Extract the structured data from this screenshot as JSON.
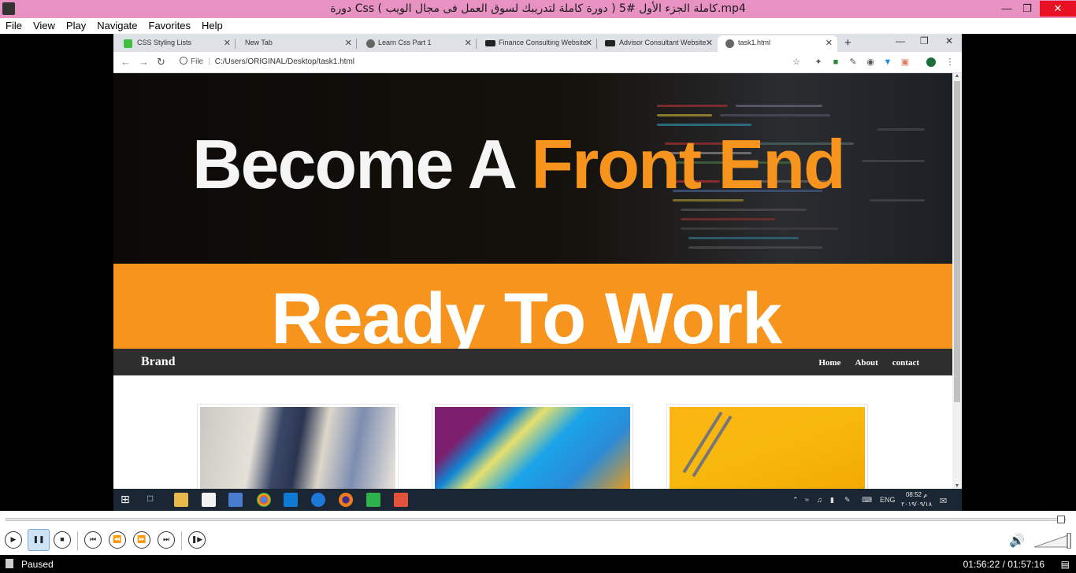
{
  "player": {
    "title": "دورة Css ( دورة كاملة لتدريبك لسوق العمل فى مجال الويب ) كاملة الجزء الأول #5.mp4",
    "menu": [
      "File",
      "View",
      "Play",
      "Navigate",
      "Favorites",
      "Help"
    ],
    "status": "Paused",
    "time": "01:56:22 / 01:57:16"
  },
  "browser": {
    "tabs": [
      {
        "label": "CSS Styling Lists",
        "favicon_color": "#3fbf3f"
      },
      {
        "label": "New Tab",
        "favicon_color": ""
      },
      {
        "label": "Learn Css Part 1",
        "favicon_color": "#666666"
      },
      {
        "label": "Finance Consulting Website",
        "favicon_color": "#222222"
      },
      {
        "label": "Advisor Consultant Website",
        "favicon_color": "#222222"
      },
      {
        "label": "task1.html",
        "favicon_color": "#666666",
        "active": true
      }
    ],
    "omnibox": {
      "scheme_label": "File",
      "url": "C:/Users/ORIGINAL/Desktop/task1.html"
    }
  },
  "page": {
    "hero": {
      "title_white": "Become A ",
      "title_orange": "Front End",
      "subtitle": "Ready To Work"
    },
    "navbar": {
      "brand": "Brand",
      "links": [
        "Home",
        "About",
        "contact"
      ]
    },
    "cards": [
      {
        "image": "office-meeting-photo"
      },
      {
        "image": "colorful-paper-photo"
      },
      {
        "image": "pencils-on-yellow-photo"
      }
    ],
    "colors": {
      "accent": "#f7941d",
      "navbar": "#2e2e2e"
    }
  },
  "taskbar": {
    "language": "ENG",
    "clock_time": "08:52 م",
    "clock_date": "٢٠١٩/٠٩/١٨"
  }
}
